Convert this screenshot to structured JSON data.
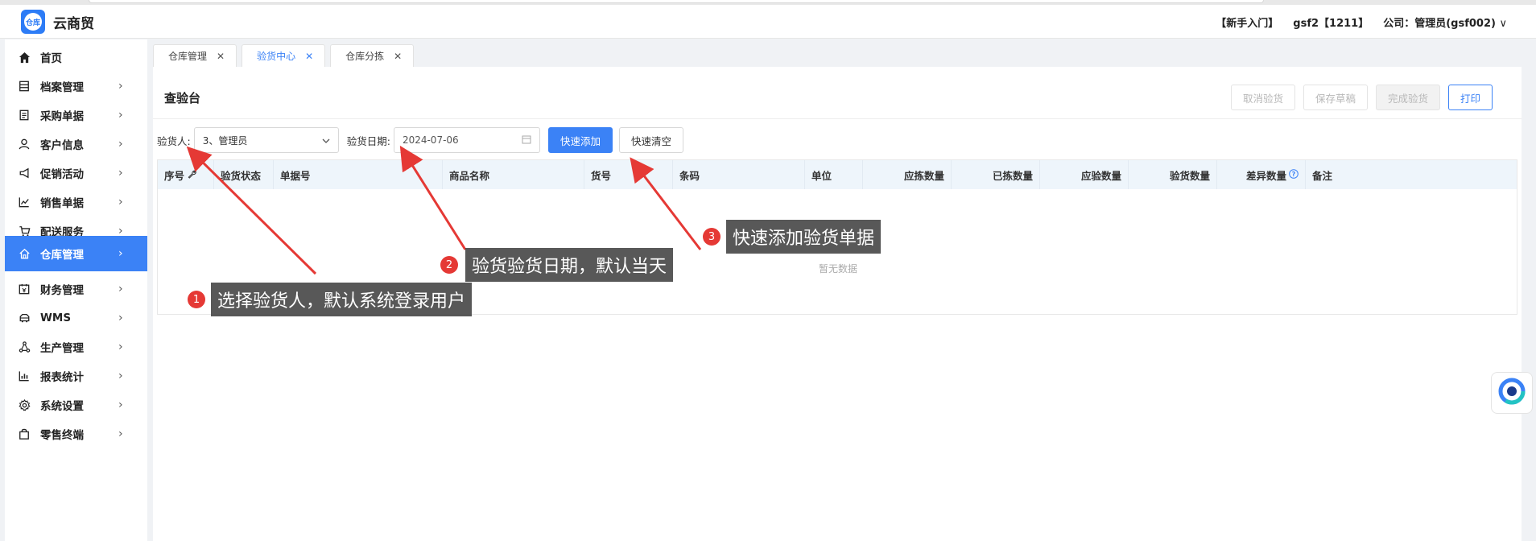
{
  "app": {
    "title": "云商贸",
    "logo_text": "仓库"
  },
  "header": {
    "guide": "【新手入门】",
    "user": "gsf2【1211】",
    "company": "公司：管理员(gsf002)",
    "chevron": "∨"
  },
  "sidebar": {
    "items": [
      {
        "label": "首页",
        "icon": "home-icon"
      },
      {
        "label": "档案管理",
        "icon": "archive-icon"
      },
      {
        "label": "采购单据",
        "icon": "purchase-icon"
      },
      {
        "label": "客户信息",
        "icon": "user-icon"
      },
      {
        "label": "促销活动",
        "icon": "megaphone-icon"
      },
      {
        "label": "销售单据",
        "icon": "chart-line-icon"
      },
      {
        "label": "配送服务",
        "icon": "cart-icon"
      },
      {
        "label": "仓库管理",
        "icon": "house-icon"
      },
      {
        "label": "财务管理",
        "icon": "finance-icon"
      },
      {
        "label": "WMS",
        "icon": "truck-icon"
      },
      {
        "label": "生产管理",
        "icon": "network-icon"
      },
      {
        "label": "报表统计",
        "icon": "bar-chart-icon"
      },
      {
        "label": "系统设置",
        "icon": "gear-icon"
      },
      {
        "label": "零售终端",
        "icon": "bag-icon"
      }
    ],
    "active_index": 7
  },
  "tabs": [
    {
      "label": "仓库管理"
    },
    {
      "label": "验货中心"
    },
    {
      "label": "仓库分拣"
    }
  ],
  "active_tab": 1,
  "page": {
    "title": "查验台"
  },
  "actions": {
    "cancel": "取消验货",
    "save_draft": "保存草稿",
    "complete": "完成验货",
    "print": "打印"
  },
  "filters": {
    "inspector_label": "验货人:",
    "inspector_value": "3、管理员",
    "date_label": "验货日期:",
    "date_value": "2024-07-06",
    "quick_add": "快速添加",
    "quick_clear": "快速清空"
  },
  "table": {
    "columns": [
      "序号",
      "验货状态",
      "单据号",
      "商品名称",
      "货号",
      "条码",
      "单位",
      "应拣数量",
      "已拣数量",
      "应验数量",
      "验货数量",
      "差异数量",
      "备注"
    ],
    "empty_text": "暂无数据"
  },
  "annotations": [
    {
      "num": "1",
      "text": "选择验货人，默认系统登录用户"
    },
    {
      "num": "2",
      "text": "验货验货日期，默认当天"
    },
    {
      "num": "3",
      "text": "快速添加验货单据"
    }
  ],
  "colors": {
    "primary": "#3b82f6",
    "badge": "#e53935",
    "callout_bg": "#464646"
  }
}
